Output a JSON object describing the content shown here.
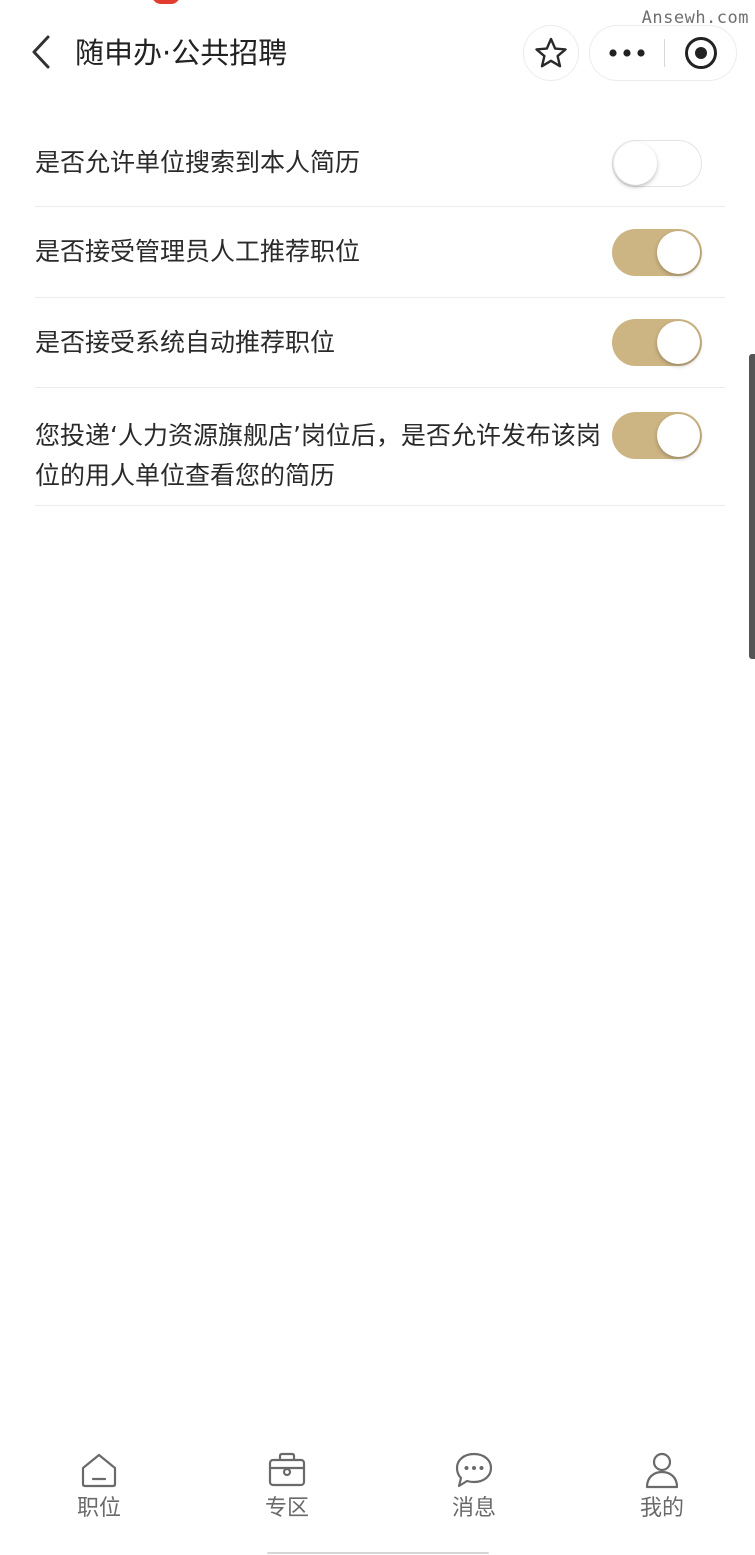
{
  "watermark": "Ansewh.com",
  "navbar": {
    "title": "随申办·公共招聘",
    "back_icon": "chevron-left-icon",
    "favorite_icon": "star-outline-icon",
    "more_icon": "more-dots-icon",
    "close_icon": "target-close-icon"
  },
  "settings": [
    {
      "label": "是否允许单位搜索到本人简历",
      "enabled": false
    },
    {
      "label": "是否接受管理员人工推荐职位",
      "enabled": true
    },
    {
      "label": "是否接受系统自动推荐职位",
      "enabled": true
    },
    {
      "label": "您投递‘人力资源旗舰店’岗位后，是否允许发布该岗位的用人单位查看您的简历",
      "enabled": true
    }
  ],
  "tabbar": {
    "items": [
      {
        "label": "职位",
        "icon": "home-icon"
      },
      {
        "label": "专区",
        "icon": "briefcase-icon"
      },
      {
        "label": "消息",
        "icon": "chat-bubble-icon"
      },
      {
        "label": "我的",
        "icon": "user-icon"
      }
    ]
  },
  "colors": {
    "switch_on": "#cdb483",
    "switch_off_border": "#e3e3e3",
    "text": "#2a2a2a",
    "divider": "#ececec",
    "tab_text": "#6a6a6a"
  }
}
